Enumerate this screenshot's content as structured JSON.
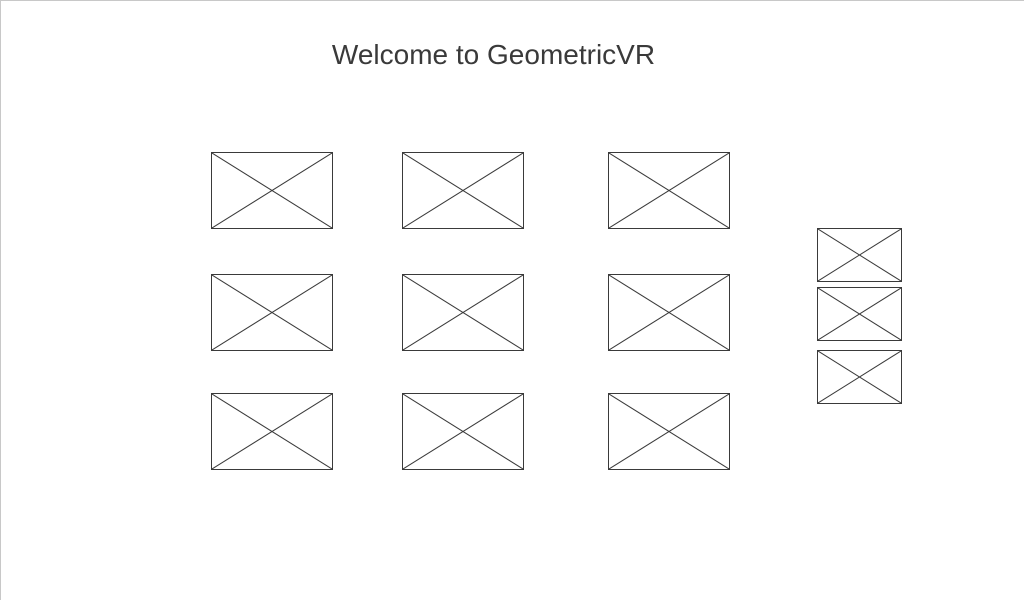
{
  "colors": {
    "title": "#3a3a3a",
    "placeholder_stroke": "#3a3a3a",
    "background": "#ffffff"
  },
  "header": {
    "title": "Welcome to GeometricVR"
  },
  "grid": {
    "items": [
      {
        "icon": "image-placeholder-icon"
      },
      {
        "icon": "image-placeholder-icon"
      },
      {
        "icon": "image-placeholder-icon"
      },
      {
        "icon": "image-placeholder-icon"
      },
      {
        "icon": "image-placeholder-icon"
      },
      {
        "icon": "image-placeholder-icon"
      },
      {
        "icon": "image-placeholder-icon"
      },
      {
        "icon": "image-placeholder-icon"
      },
      {
        "icon": "image-placeholder-icon"
      }
    ]
  },
  "side_list": {
    "items": [
      {
        "icon": "image-placeholder-icon"
      },
      {
        "icon": "image-placeholder-icon"
      },
      {
        "icon": "image-placeholder-icon"
      }
    ]
  }
}
